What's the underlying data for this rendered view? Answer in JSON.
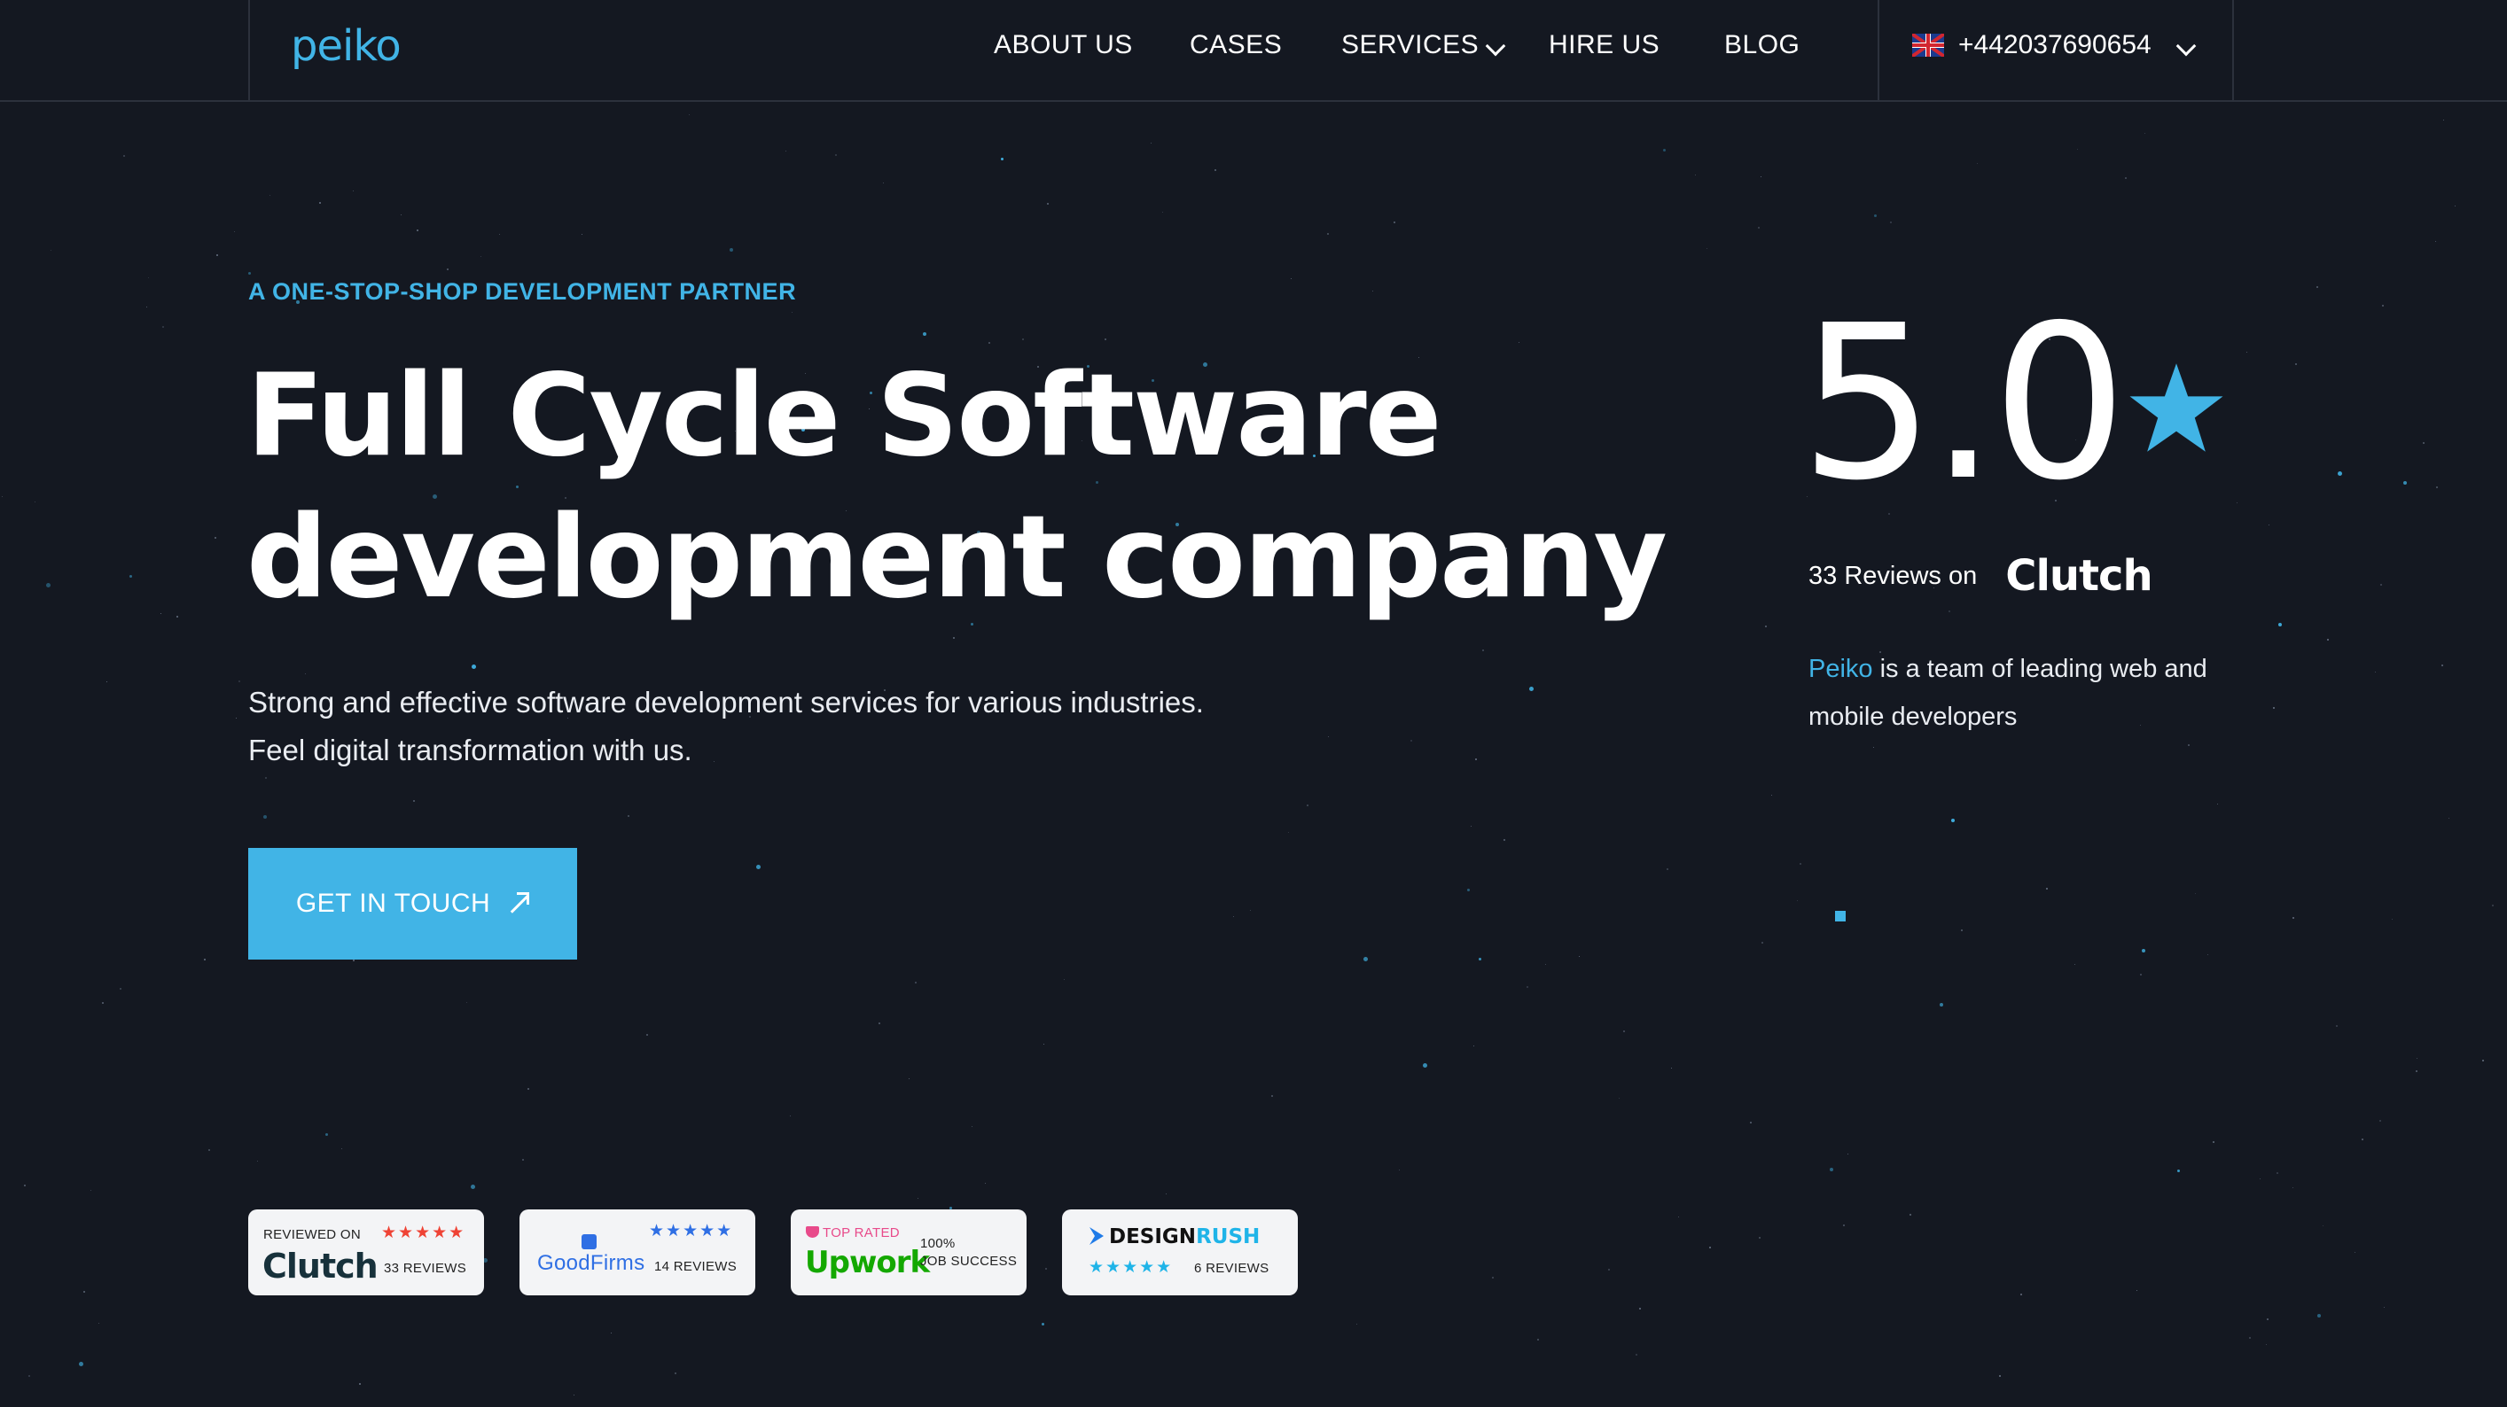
{
  "header": {
    "logo_text": "peiko",
    "nav": [
      {
        "label": "ABOUT US"
      },
      {
        "label": "CASES"
      },
      {
        "label": "SERVICES"
      },
      {
        "label": "HIRE US"
      },
      {
        "label": "BLOG"
      }
    ],
    "phone": "+442037690654"
  },
  "hero": {
    "eyebrow": "A ONE-STOP-SHOP DEVELOPMENT PARTNER",
    "title_line1": "Full Cycle Software",
    "title_line2": "development company",
    "subtitle": "Strong and effective software development services for various industries. Feel digital transformation with us.",
    "cta_label": "GET IN TOUCH"
  },
  "rating": {
    "score": "5.0",
    "reviews_text": "33 Reviews on",
    "platform": "Clutch",
    "brand": "Peiko",
    "description": " is a team of leading web and mobile developers"
  },
  "badges": {
    "clutch": {
      "top": "REVIEWED ON",
      "name": "Clutch",
      "reviews": "33 REVIEWS",
      "stars": "★★★★★"
    },
    "goodfirms": {
      "name": "GoodFirms",
      "reviews": "14 REVIEWS",
      "stars": "★★★★★"
    },
    "upwork": {
      "top": "TOP RATED",
      "name": "Upwork",
      "pct": "100%",
      "success": "JOB SUCCESS"
    },
    "designrush": {
      "name_a": "DESIGN",
      "name_b": "RUSH",
      "reviews": "6 REVIEWS",
      "stars": "★★★★★"
    }
  },
  "colors": {
    "background": "#141821",
    "accent": "#41b4e6",
    "star_red": "#ef4335"
  }
}
